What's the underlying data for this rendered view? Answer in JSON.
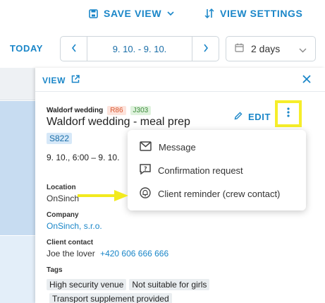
{
  "toolbar": {
    "save_view_label": "SAVE VIEW",
    "view_settings_label": "VIEW SETTINGS"
  },
  "date_bar": {
    "today_label": "TODAY",
    "range": "9. 10. - 9. 10.",
    "days_selected": "2 days"
  },
  "panel": {
    "view_label": "VIEW",
    "small_title": "Waldorf wedding",
    "badge_r": "R86",
    "badge_j": "J303",
    "title": "Waldorf wedding - meal prep",
    "edit_label": "EDIT",
    "badge_s": "S822",
    "datetime": "9. 10., 6:00 – 9. 10.",
    "location_label": "Location",
    "location_value": "OnSinch",
    "company_label": "Company",
    "company_value": "OnSinch, s.r.o.",
    "client_contact_label": "Client contact",
    "client_contact_name": "Joe the lover",
    "client_contact_phone": "+420 606 666 666",
    "tags_label": "Tags",
    "tags": [
      "High security venue",
      "Not suitable for girls",
      "Transport supplement provided"
    ]
  },
  "menu": {
    "items": [
      {
        "label": "Message",
        "icon": "message-icon"
      },
      {
        "label": "Confirmation request",
        "icon": "confirmation-request-icon"
      },
      {
        "label": "Client reminder (crew contact)",
        "icon": "bell-icon"
      }
    ]
  },
  "colors": {
    "accent": "#1a86c8",
    "highlight": "#f6ee2a",
    "arrow": "#f2ea1e"
  }
}
